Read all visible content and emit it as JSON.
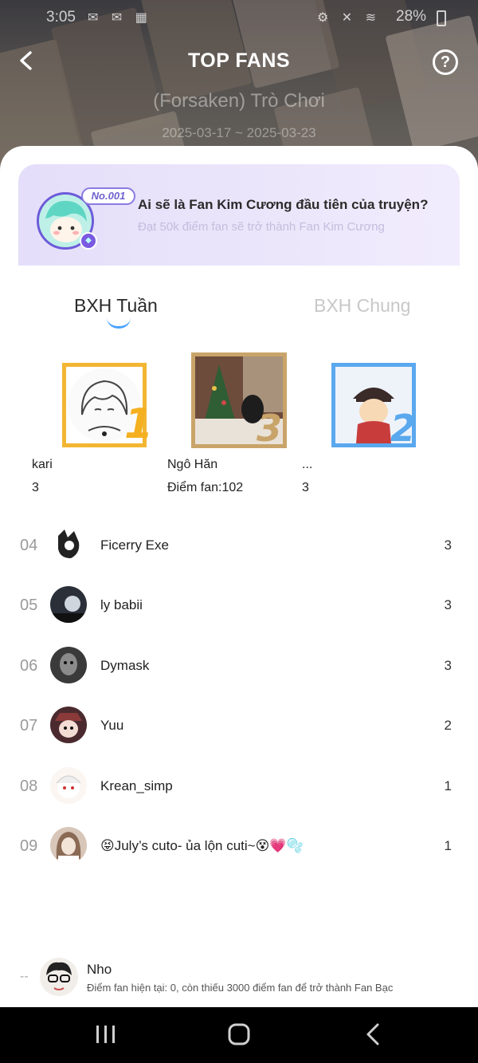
{
  "status_bar": {
    "time": "3:05",
    "left_icons": "✉ ✉ ▦",
    "right_icons": "⚙ ✕ ≋",
    "battery": "28%"
  },
  "header": {
    "title": "TOP FANS",
    "story_title": "(Forsaken) Trò Chơi",
    "date_range": "2025-03-17 ~ 2025-03-23",
    "back_icon": "back-arrow-icon",
    "help_icon": "question-mark-icon",
    "help_symbol": "?"
  },
  "promo": {
    "badge": "No.001",
    "title": "Ai sẽ là Fan Kim Cương đầu tiên của truyện?",
    "subtitle": "Đạt 50k điểm fan sẽ trở thành Fan Kim Cương",
    "gem_symbol": "◆"
  },
  "tabs": [
    {
      "label": "BXH Tuần",
      "active": true
    },
    {
      "label": "BXH Chung",
      "active": false
    }
  ],
  "podium": {
    "first": {
      "rank": "1",
      "name": "kari",
      "score": "3"
    },
    "third": {
      "rank": "3",
      "name": "Ngô Hăn",
      "score": "Điểm fan:102"
    },
    "second": {
      "rank": "2",
      "name": "...",
      "score": "3"
    }
  },
  "list": [
    {
      "rank": "04",
      "name": "Ficerry Exe",
      "points": "3"
    },
    {
      "rank": "05",
      "name": "ly babii",
      "points": "3"
    },
    {
      "rank": "06",
      "name": "Dymask",
      "points": "3"
    },
    {
      "rank": "07",
      "name": "Yuu",
      "points": "2"
    },
    {
      "rank": "08",
      "name": "Krean_simp",
      "points": "1"
    },
    {
      "rank": "09",
      "name": "😝July’s cuto- ủa lộn cuti~😵💗🫧",
      "points": "1"
    }
  ],
  "me": {
    "rank": "--",
    "name": "Nho",
    "note": "Điểm fan hiện tại: 0, còn thiếu 3000 điểm fan để trở thành Fan Bạc"
  },
  "colors": {
    "accent": "#4aa3ff",
    "gold": "#f2b632",
    "silver": "#5aa8ee",
    "bronze": "#c9a46a",
    "promo_bg": "#e8e2fb"
  }
}
